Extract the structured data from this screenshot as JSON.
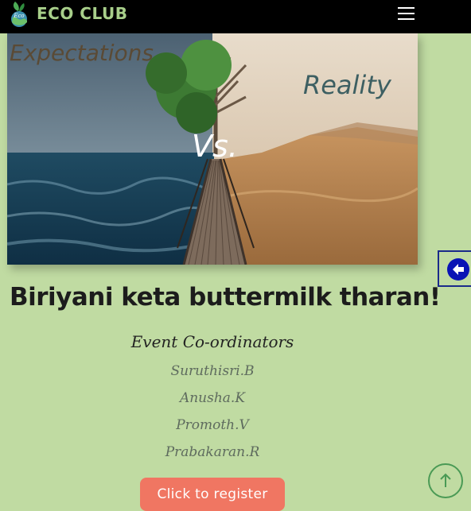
{
  "header": {
    "brand": "ECO CLUB",
    "logo_text": "Eco"
  },
  "banner": {
    "left_caption": "Expectations",
    "right_caption": "Reality",
    "center_caption": "Vs."
  },
  "event": {
    "title": "Biriyani keta buttermilk tharan!",
    "coordinators_heading": "Event Co-ordinators",
    "coordinators": [
      "Suruthisri.B",
      "Anusha.K",
      "Promoth.V",
      "Prabakaran.R"
    ],
    "register_label": "Click to register"
  },
  "icons": {
    "menu": "hamburger-menu-icon",
    "side": "arrow-left-circle-icon",
    "top": "arrow-up-icon"
  },
  "colors": {
    "background": "#c0dba2",
    "navbar": "#000000",
    "brand": "#a8cf8a",
    "register_button": "#f07662",
    "side_icon": "#0a14b5",
    "top_button_border": "#4a9a55"
  }
}
